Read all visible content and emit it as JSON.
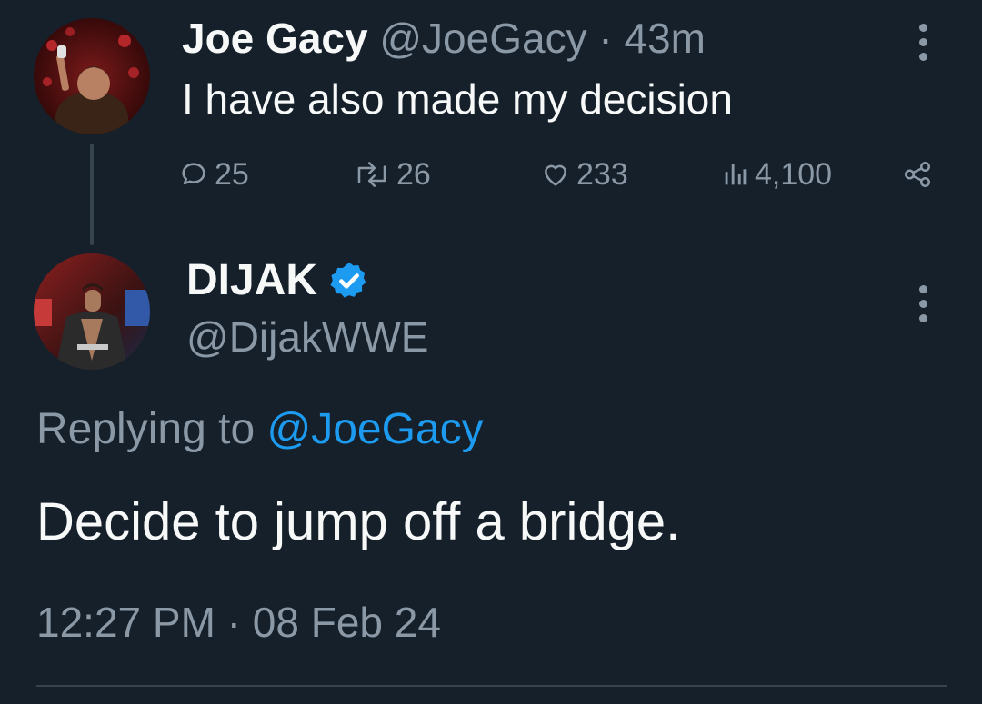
{
  "parent_tweet": {
    "author_name": "Joe Gacy",
    "author_handle": "@JoeGacy",
    "separator": "·",
    "time_ago": "43m",
    "text": "I have also made my decision",
    "stats": {
      "replies": "25",
      "retweets": "26",
      "likes": "233",
      "views": "4,100"
    }
  },
  "reply_tweet": {
    "author_name": "DIJAK",
    "verified": true,
    "author_handle": "@DijakWWE",
    "replying_to_label": "Replying to",
    "replying_to_handle": "@JoeGacy",
    "text": "Decide to jump off a bridge.",
    "timestamp": "12:27 PM · 08 Feb 24"
  },
  "icons": {
    "reply": "reply-icon",
    "retweet": "retweet-icon",
    "like": "like-icon",
    "views": "views-icon",
    "share": "share-icon",
    "more": "more-icon",
    "verified": "verified-badge-icon"
  },
  "colors": {
    "background": "#15202b",
    "text": "#f7f9f9",
    "muted": "#8b98a5",
    "accent": "#1d9bf0",
    "divider": "#38444d"
  }
}
